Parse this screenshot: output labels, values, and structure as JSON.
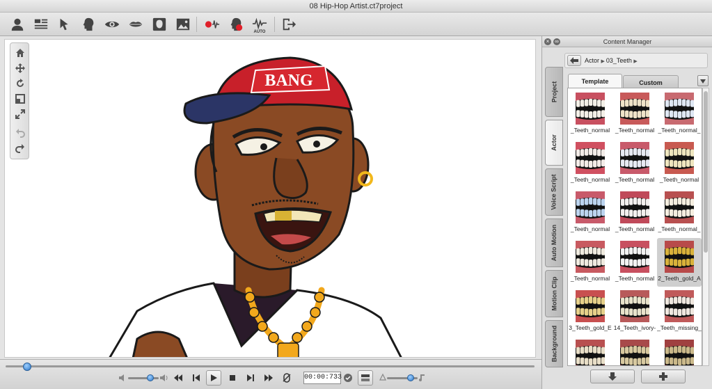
{
  "window": {
    "title": "08 Hip-Hop Artist.ct7project"
  },
  "toolbar": {
    "icons": [
      "actor-icon",
      "scene-icon",
      "pointer-icon",
      "head-icon",
      "eye-icon",
      "lips-icon",
      "face-frame-icon",
      "image-icon",
      "record-audio-icon",
      "record-face-icon",
      "auto-audio-icon",
      "export-icon"
    ],
    "auto_label": "AUTO"
  },
  "stage": {
    "cap_text": "BANG",
    "colors": {
      "skin": "#8a4a24",
      "cap": "#c8202a",
      "brim": "#2b3566",
      "chain": "#f2a81c",
      "shirt": "#ffffff"
    }
  },
  "timeline": {
    "timecode": "00:00:733"
  },
  "content_manager": {
    "title": "Content Manager",
    "breadcrumb": [
      "Actor",
      "03_Teeth"
    ],
    "tabs": {
      "template": "Template",
      "custom": "Custom"
    },
    "side_tabs": [
      "Project",
      "Actor",
      "Voice Script",
      "Auto Motion",
      "Motion Clip",
      "Background"
    ],
    "items": [
      {
        "label": "_Teeth_normal",
        "tint": "#f3efe7",
        "gum": "#c85060"
      },
      {
        "label": "_Teeth_normal",
        "tint": "#efe3c8",
        "gum": "#c85a5a"
      },
      {
        "label": "_Teeth_normal_",
        "tint": "#dfe7f3",
        "gum": "#c86a70"
      },
      {
        "label": "_Teeth_normal",
        "tint": "#f3ece8",
        "gum": "#d05060"
      },
      {
        "label": "_Teeth_normal",
        "tint": "#e7eaf3",
        "gum": "#c85a6a"
      },
      {
        "label": "_Teeth_normal",
        "tint": "#efe6bf",
        "gum": "#c85a50"
      },
      {
        "label": "_Teeth_normal",
        "tint": "#bcd4ef",
        "gum": "#c85a6a"
      },
      {
        "label": "_Teeth_normal",
        "tint": "#f3f0ef",
        "gum": "#c04a5a"
      },
      {
        "label": "_Teeth_normal_",
        "tint": "#f5eee0",
        "gum": "#b85050"
      },
      {
        "label": "_Teeth_normal",
        "tint": "#f0ebe0",
        "gum": "#c85a60"
      },
      {
        "label": "_Teeth_normal",
        "tint": "#f3f3f3",
        "gum": "#c85060"
      },
      {
        "label": "2_Teeth_gold_A",
        "tint": "#d9b23a",
        "gum": "#b84a4a"
      },
      {
        "label": "3_Teeth_gold_E",
        "tint": "#e7d18a",
        "gum": "#c85050"
      },
      {
        "label": "14_Teeth_ivory-",
        "tint": "#e9e4cc",
        "gum": "#b85a5a"
      },
      {
        "label": "_Teeth_missing_",
        "tint": "#f0e8e0",
        "gum": "#c05a5a"
      },
      {
        "label": "",
        "tint": "#e9dfc8",
        "gum": "#b85050"
      },
      {
        "label": "",
        "tint": "#d8c9a0",
        "gum": "#a84a4a"
      },
      {
        "label": "",
        "tint": "#cbb98a",
        "gum": "#a04040"
      }
    ],
    "selected_index": 11
  }
}
